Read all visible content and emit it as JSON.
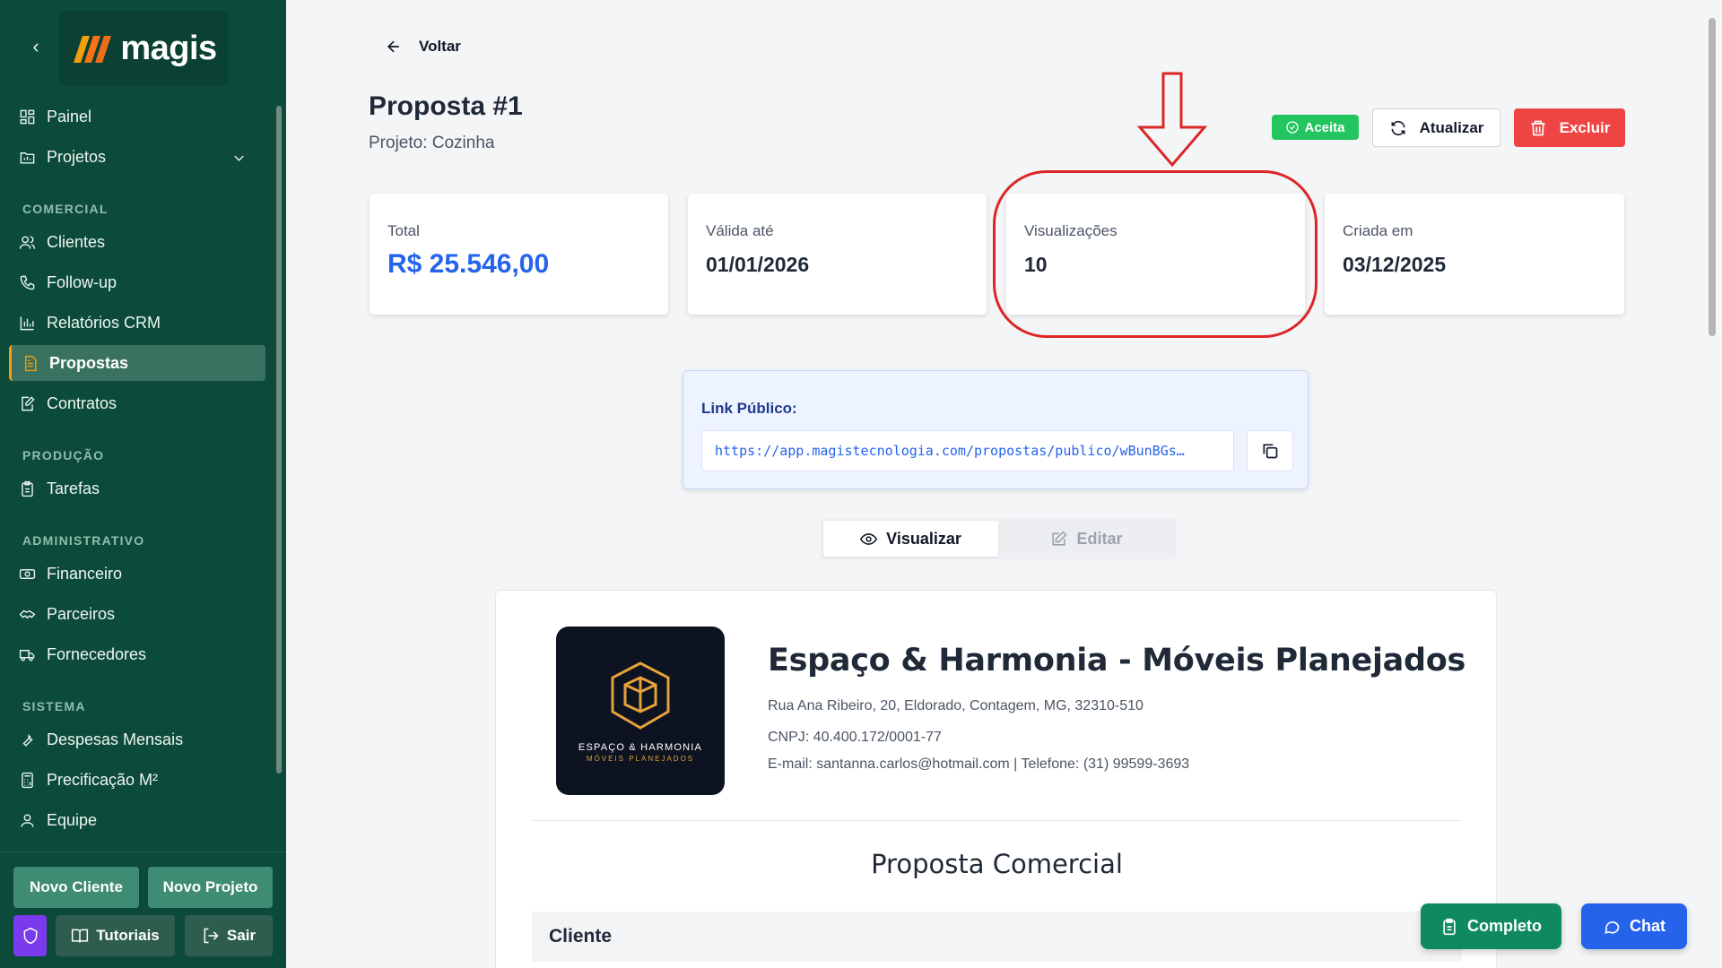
{
  "sidebar": {
    "logo_text": "magis",
    "items": {
      "painel": "Painel",
      "projetos": "Projetos",
      "clientes": "Clientes",
      "followup": "Follow-up",
      "relatorios": "Relatórios CRM",
      "propostas": "Propostas",
      "contratos": "Contratos",
      "tarefas": "Tarefas",
      "financeiro": "Financeiro",
      "parceiros": "Parceiros",
      "fornecedores": "Fornecedores",
      "despesas": "Despesas Mensais",
      "precificacao": "Precificação M²",
      "equipe": "Equipe"
    },
    "sections": {
      "comercial": "COMERCIAL",
      "producao": "PRODUÇÃO",
      "administrativo": "ADMINISTRATIVO",
      "sistema": "SISTEMA"
    },
    "buttons": {
      "novo_cliente": "Novo Cliente",
      "novo_projeto": "Novo Projeto",
      "tutoriais": "Tutoriais",
      "sair": "Sair"
    }
  },
  "header": {
    "back_label": "Voltar",
    "title": "Proposta #1",
    "subtitle": "Projeto: Cozinha",
    "status_badge": "Aceita",
    "update_label": "Atualizar",
    "delete_label": "Excluir"
  },
  "stats": {
    "total_label": "Total",
    "total_value": "R$ 25.546,00",
    "valid_label": "Válida até",
    "valid_value": "01/01/2026",
    "views_label": "Visualizações",
    "views_value": "10",
    "created_label": "Criada em",
    "created_value": "03/12/2025"
  },
  "public_link": {
    "title": "Link Público:",
    "url": "https://app.magistecnologia.com/propostas/publico/wBunBGs…"
  },
  "tabs": {
    "view": "Visualizar",
    "edit": "Editar"
  },
  "document": {
    "logo_line1": "ESPAÇO & HARMONIA",
    "logo_line2": "MÓVEIS PLANEJADOS",
    "company_name": "Espaço & Harmonia - Móveis Planejados",
    "address": "Rua Ana Ribeiro, 20, Eldorado, Contagem, MG, 32310-510",
    "cnpj": "CNPJ: 40.400.172/0001-77",
    "contact": "E-mail: santanna.carlos@hotmail.com | Telefone: (31) 99599-3693",
    "heading": "Proposta Comercial",
    "client_section": "Cliente"
  },
  "floating": {
    "completo": "Completo",
    "chat": "Chat"
  },
  "colors": {
    "sidebar_bg": "#0c4a3a",
    "accent_orange": "#f59e0b",
    "primary_blue": "#2563eb",
    "danger_red": "#ef4444",
    "success_green": "#22c55e",
    "annotation_red": "#dc2626"
  }
}
